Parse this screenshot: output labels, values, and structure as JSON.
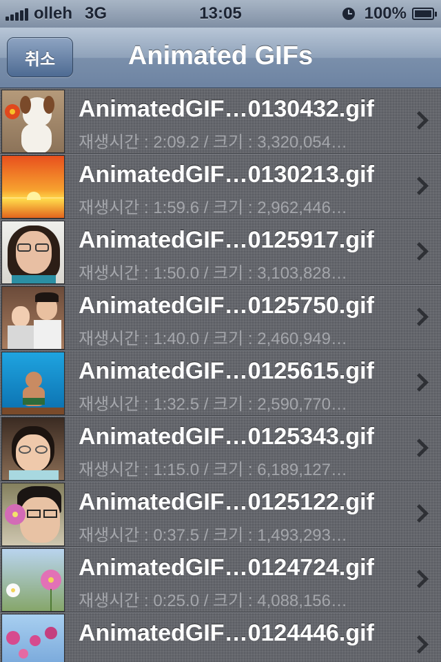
{
  "status_bar": {
    "carrier": "olleh",
    "network": "3G",
    "time": "13:05",
    "battery": "100%"
  },
  "nav": {
    "cancel_label": "취소",
    "title": "Animated GIFs"
  },
  "items": [
    {
      "title": "AnimatedGIF…0130432.gif",
      "subtitle": "재생시간 : 2:09.2 / 크기 : 3,320,054…",
      "thumb": "dog"
    },
    {
      "title": "AnimatedGIF…0130213.gif",
      "subtitle": "재생시간 : 1:59.6 / 크기 : 2,962,446…",
      "thumb": "sunset"
    },
    {
      "title": "AnimatedGIF…0125917.gif",
      "subtitle": "재생시간 : 1:50.0 / 크기 : 3,103,828…",
      "thumb": "woman"
    },
    {
      "title": "AnimatedGIF…0125750.gif",
      "subtitle": "재생시간 : 1:40.0 / 크기 : 2,460,949…",
      "thumb": "kids"
    },
    {
      "title": "AnimatedGIF…0125615.gif",
      "subtitle": "재생시간 : 1:32.5 / 크기 : 2,590,770…",
      "thumb": "pool"
    },
    {
      "title": "AnimatedGIF…0125343.gif",
      "subtitle": "재생시간 : 1:15.0 / 크기 : 6,189,127…",
      "thumb": "boy"
    },
    {
      "title": "AnimatedGIF…0125122.gif",
      "subtitle": "재생시간 : 0:37.5 / 크기 : 1,493,293…",
      "thumb": "teen"
    },
    {
      "title": "AnimatedGIF…0124724.gif",
      "subtitle": "재생시간 : 0:25.0 / 크기 : 4,088,156…",
      "thumb": "flower1"
    },
    {
      "title": "AnimatedGIF…0124446.gif",
      "subtitle": "",
      "thumb": "flower2"
    }
  ],
  "icons": {
    "signal": "signal-bars-icon",
    "clock": "clock-icon",
    "battery": "battery-charging-icon",
    "chevron": "chevron-right-icon"
  },
  "colors": {
    "nav_blue": "#6d83a2",
    "row_bg": "#62646a",
    "subtitle": "#a4a6ab"
  }
}
